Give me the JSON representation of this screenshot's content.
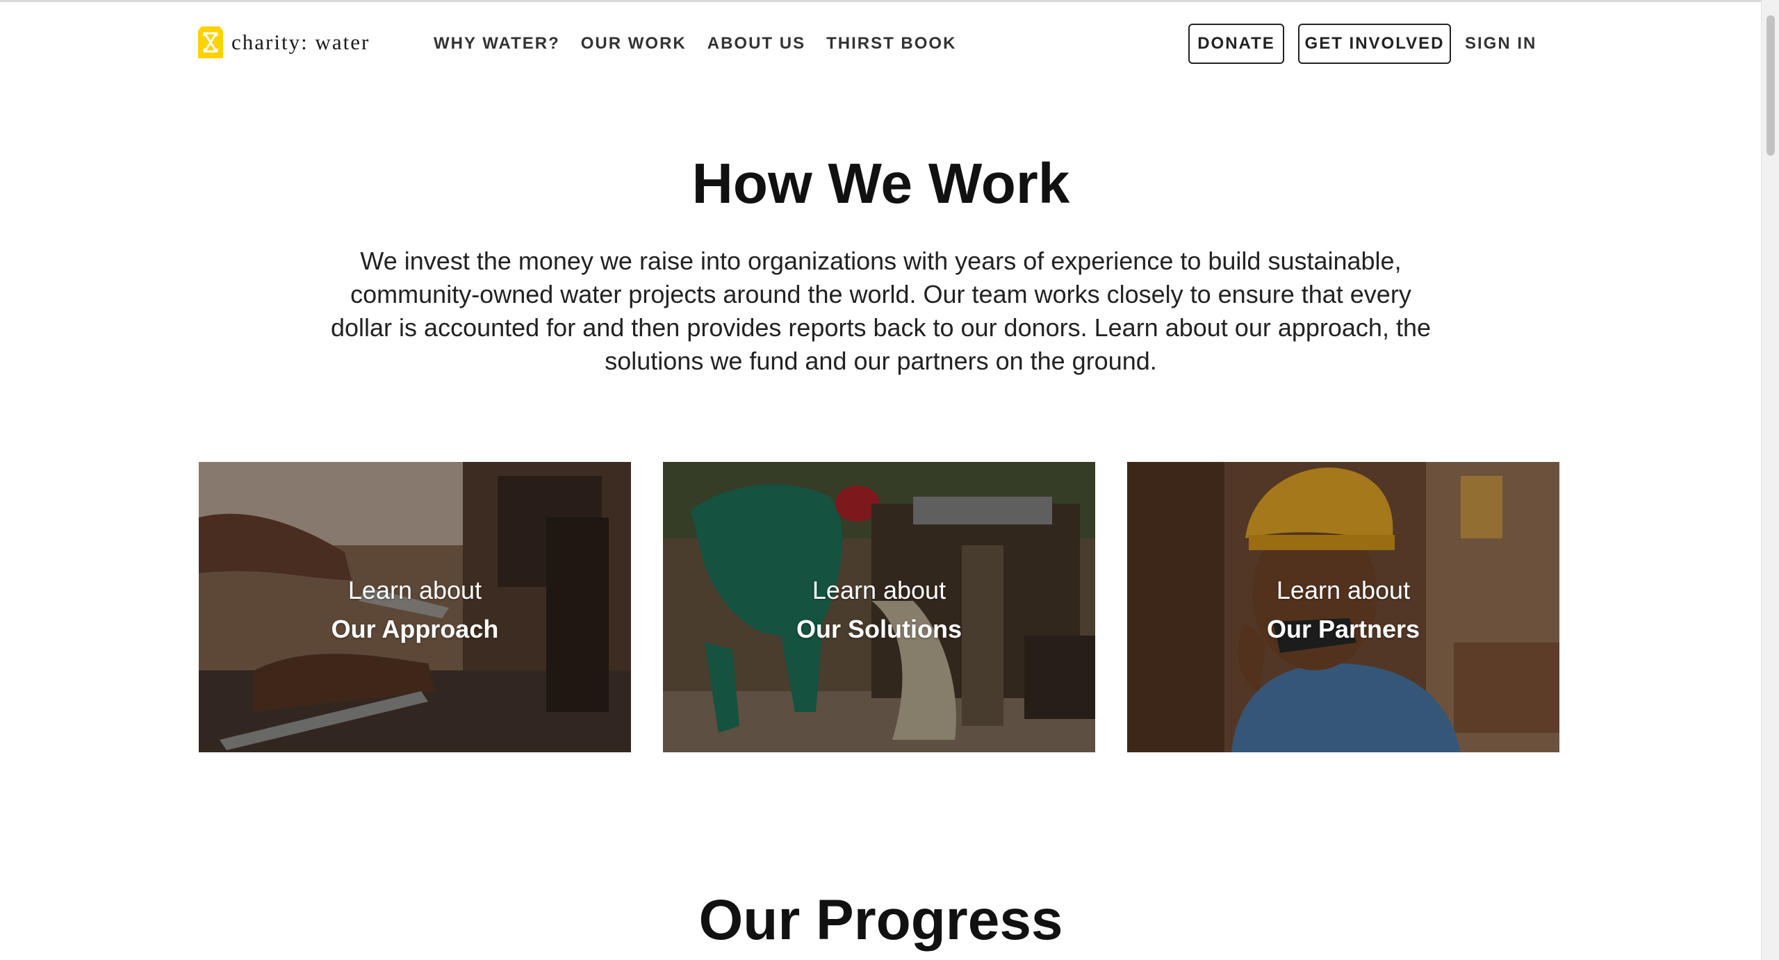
{
  "header": {
    "logo_text": "charity: water",
    "logo_color": "#FFD200",
    "nav": [
      {
        "label": "WHY WATER?"
      },
      {
        "label": "OUR WORK"
      },
      {
        "label": "ABOUT US"
      },
      {
        "label": "THIRST BOOK"
      }
    ],
    "donate_label": "DONATE",
    "get_involved_label": "GET INVOLVED",
    "sign_in_label": "SIGN IN"
  },
  "hero": {
    "title": "How We Work",
    "intro": "We invest the money we raise into organizations with years of experience to build sustainable, community-owned water projects around the world. Our team works closely to ensure that every dollar is accounted for and then provides reports back to our donors. Learn about our approach, the solutions we fund and our partners on the ground."
  },
  "cards": [
    {
      "line1": "Learn about",
      "line2": "Our Approach"
    },
    {
      "line1": "Learn about",
      "line2": "Our Solutions"
    },
    {
      "line1": "Learn about",
      "line2": "Our Partners"
    }
  ],
  "progress": {
    "title": "Our Progress"
  }
}
